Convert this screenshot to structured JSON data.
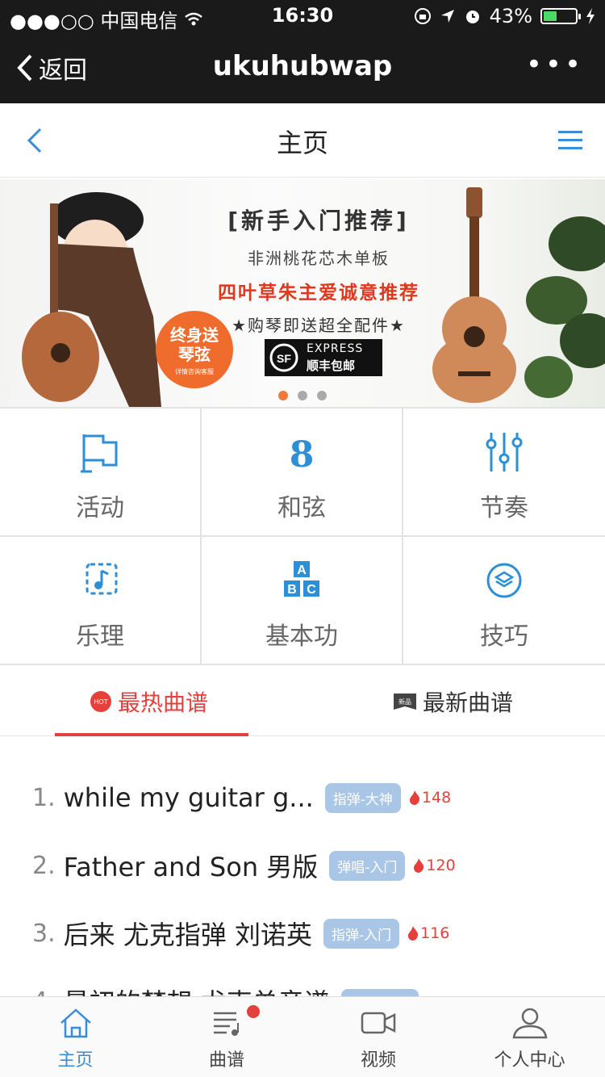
{
  "status_bar": {
    "carrier": "●●●○○ 中国电信",
    "time": "16:30",
    "battery": "43%",
    "battery_level": 0.43
  },
  "wechat_bar": {
    "back_label": "返回",
    "title": "ukuhubwap",
    "more_label": "•••"
  },
  "header": {
    "title": "主页"
  },
  "banner": {
    "headline": "[新手入门推荐]",
    "line2": "非洲桃花芯木单板",
    "line3": "四叶草朱主爱诚意推荐",
    "line4": "★购琴即送超全配件★",
    "badge_main": "终身送\n琴弦",
    "badge_sub": "详情咨询客服",
    "express_label": "EXPRESS",
    "express_sub": "顺丰包邮",
    "slides": 3,
    "active_slide": 1
  },
  "grid": [
    {
      "label": "活动",
      "icon": "flag-icon"
    },
    {
      "label": "和弦",
      "icon": "chord-8-icon"
    },
    {
      "label": "节奏",
      "icon": "sliders-icon"
    },
    {
      "label": "乐理",
      "icon": "music-note-icon"
    },
    {
      "label": "基本功",
      "icon": "abc-blocks-icon"
    },
    {
      "label": "技巧",
      "icon": "layers-icon"
    }
  ],
  "tabs": {
    "hot_label": "最热曲谱",
    "hot_badge": "HOT",
    "new_label": "最新曲谱",
    "new_badge": "新品"
  },
  "songs": [
    {
      "num": "1.",
      "name": "while my guitar g...",
      "tag": "指弹-大神",
      "heat": "148"
    },
    {
      "num": "2.",
      "name": "Father and Son 男版",
      "tag": "弹唱-入门",
      "heat": "120"
    },
    {
      "num": "3.",
      "name": "后来 尤克指弹 刘诺英",
      "tag": "指弹-入门",
      "heat": "116"
    },
    {
      "num": "4.",
      "name": "最初的梦想 尤克单音谱",
      "tag": "",
      "heat": ""
    }
  ],
  "tabbar": [
    {
      "label": "主页",
      "icon": "home-icon",
      "active": true
    },
    {
      "label": "曲谱",
      "icon": "score-icon",
      "active": false
    },
    {
      "label": "视频",
      "icon": "video-icon",
      "active": false
    },
    {
      "label": "个人中心",
      "icon": "user-icon",
      "active": false
    }
  ],
  "colors": {
    "accent_blue": "#3a8bd8",
    "hot_red": "#e5403b",
    "tag_blue": "#a9c6e6"
  }
}
